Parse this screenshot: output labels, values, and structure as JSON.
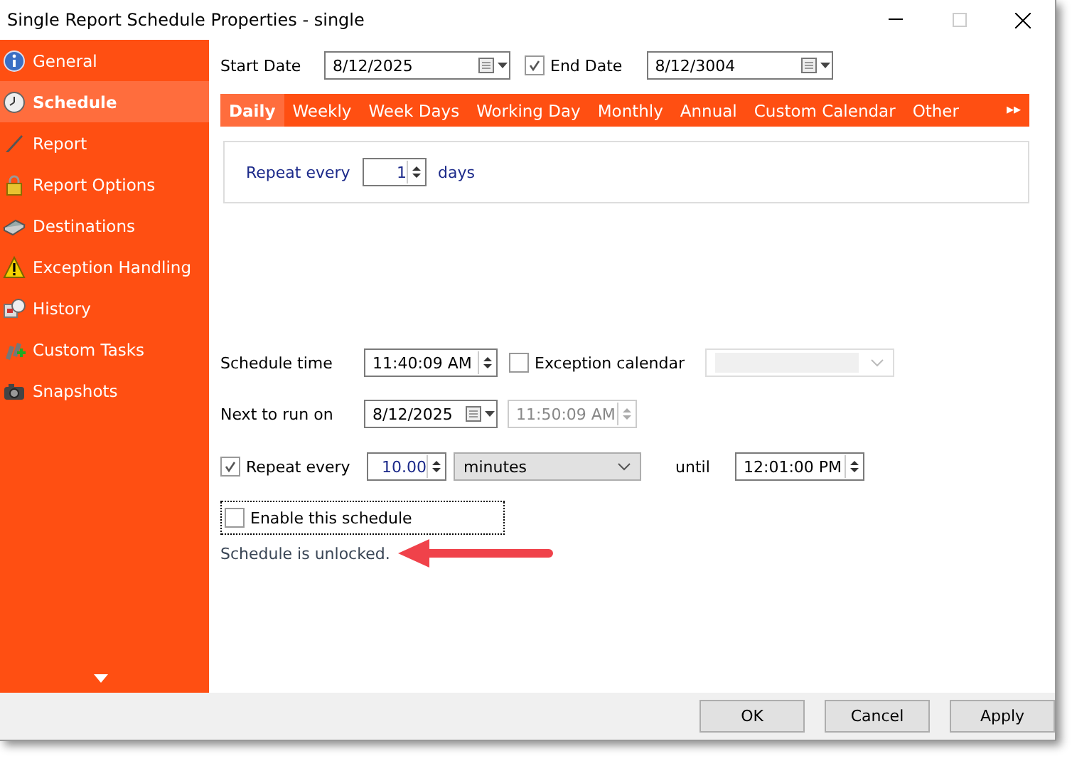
{
  "window": {
    "title": "Single Report Schedule Properties - single"
  },
  "sidebar": {
    "items": [
      {
        "label": "General",
        "selected": false
      },
      {
        "label": "Schedule",
        "selected": true
      },
      {
        "label": "Report",
        "selected": false
      },
      {
        "label": "Report Options",
        "selected": false
      },
      {
        "label": "Destinations",
        "selected": false
      },
      {
        "label": "Exception Handling",
        "selected": false
      },
      {
        "label": "History",
        "selected": false
      },
      {
        "label": "Custom Tasks",
        "selected": false
      },
      {
        "label": "Snapshots",
        "selected": false
      }
    ]
  },
  "dates": {
    "start_label": "Start Date",
    "start_value": "8/12/2025",
    "end_checked": true,
    "end_label": "End Date",
    "end_value": "8/12/3004"
  },
  "tabs": [
    {
      "label": "Daily",
      "selected": true
    },
    {
      "label": "Weekly",
      "selected": false
    },
    {
      "label": "Week Days",
      "selected": false
    },
    {
      "label": "Working Day",
      "selected": false
    },
    {
      "label": "Monthly",
      "selected": false
    },
    {
      "label": "Annual",
      "selected": false
    },
    {
      "label": "Custom Calendar",
      "selected": false
    },
    {
      "label": "Other",
      "selected": false
    }
  ],
  "tabs_more": "▸▸",
  "daily": {
    "label": "Repeat every",
    "value": "1",
    "unit": "days"
  },
  "schedule_time": {
    "label": "Schedule time",
    "value": "11:40:09 AM",
    "exception_checked": false,
    "exception_label": "Exception calendar"
  },
  "next_run": {
    "label": "Next to run on",
    "date": "8/12/2025",
    "time": "11:50:09 AM"
  },
  "repeat": {
    "checked": true,
    "label": "Repeat every",
    "value": "10.00",
    "unit": "minutes",
    "until_label": "until",
    "until": "12:01:00 PM"
  },
  "enable": {
    "checked": false,
    "label": "Enable this schedule"
  },
  "status": "Schedule is unlocked.",
  "buttons": [
    "OK",
    "Cancel",
    "Apply"
  ]
}
